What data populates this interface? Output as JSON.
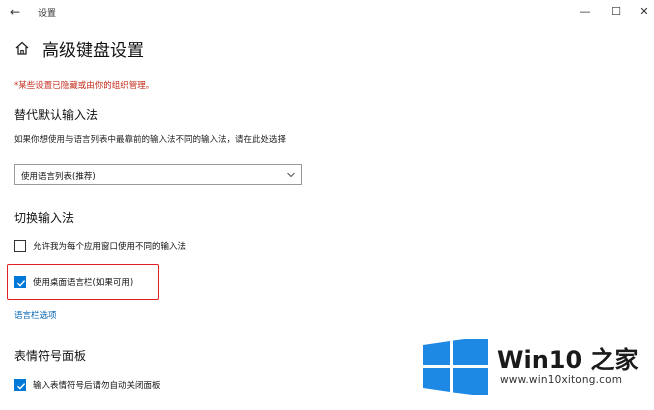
{
  "window": {
    "title": "设置",
    "back_icon": "←",
    "minimize_icon": "—",
    "maximize_icon": "☐",
    "close_icon": "✕"
  },
  "page": {
    "title": "高级键盘设置",
    "notice": "*某些设置已隐藏或由你的组织管理。"
  },
  "override_input": {
    "heading": "替代默认输入法",
    "description": "如果你想使用与语言列表中最靠前的输入法不同的输入法，请在此处选择",
    "dropdown_value": "使用语言列表(推荐)"
  },
  "switch_input": {
    "heading": "切换输入法",
    "per_app_label": "允许我为每个应用窗口使用不同的输入法",
    "per_app_checked": false,
    "desktop_bar_label": "使用桌面语言栏(如果可用)",
    "desktop_bar_checked": true,
    "highlight_color": "#e02020",
    "language_bar_link": "语言栏选项"
  },
  "emoji_panel": {
    "heading": "表情符号面板",
    "auto_close_label": "输入表情符号后请勿自动关闭面板",
    "auto_close_checked": true
  },
  "colors": {
    "accent": "#0078d7",
    "link": "#0063b1",
    "notice": "#c42b1c",
    "watermark_blue": "#1e88e5"
  },
  "watermark": {
    "brand": "Win10 之家",
    "url": "www.win10xitong.com"
  }
}
